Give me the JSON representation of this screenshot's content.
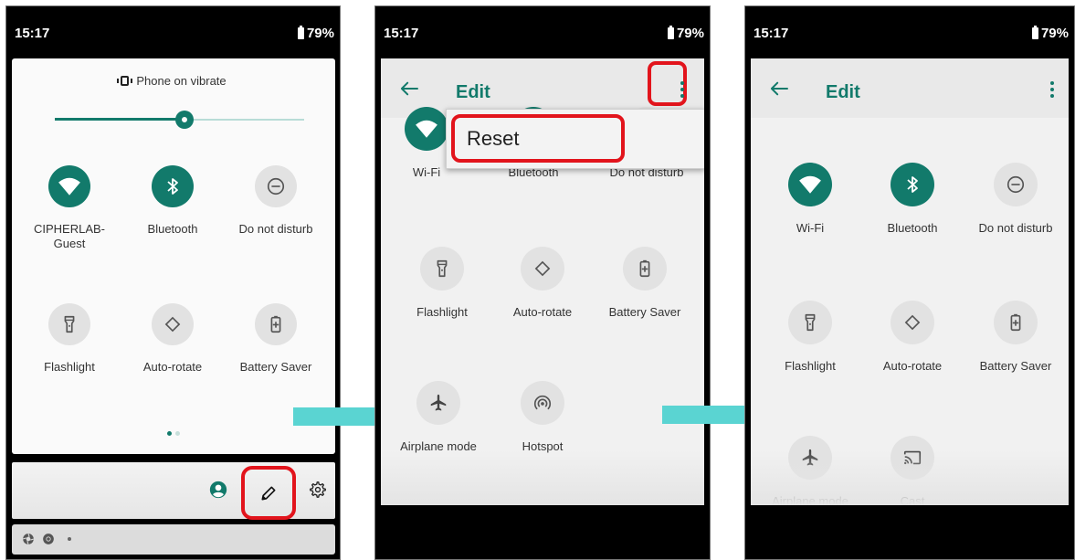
{
  "colors": {
    "accent": "#127a6b",
    "highlight": "#e2141c",
    "arrow": "#5ad4d2"
  },
  "status": {
    "time": "15:17",
    "battery": "79%"
  },
  "panel1": {
    "ringer": "Phone on vibrate",
    "brightness": 0.52,
    "tiles": [
      {
        "label": "CIPHERLAB-\nGuest",
        "icon": "wifi-icon",
        "on": true
      },
      {
        "label": "Bluetooth",
        "icon": "bluetooth-icon",
        "on": true
      },
      {
        "label": "Do not disturb",
        "icon": "do-not-disturb-icon",
        "on": false
      },
      {
        "label": "Flashlight",
        "icon": "flashlight-icon",
        "on": false
      },
      {
        "label": "Auto-rotate",
        "icon": "auto-rotate-icon",
        "on": false
      },
      {
        "label": "Battery Saver",
        "icon": "battery-saver-icon",
        "on": false
      }
    ],
    "page_dots": 2,
    "active_page": 1
  },
  "panel2": {
    "title": "Edit",
    "menu_item": "Reset",
    "tiles": [
      {
        "label": "Wi-Fi"
      },
      {
        "label": "Bluetooth"
      },
      {
        "label": "Do not disturb"
      },
      {
        "label": "Flashlight",
        "icon": "flashlight-icon"
      },
      {
        "label": "Auto-rotate",
        "icon": "auto-rotate-icon"
      },
      {
        "label": "Battery Saver",
        "icon": "battery-saver-icon"
      },
      {
        "label": "Airplane mode",
        "icon": "airplane-icon"
      },
      {
        "label": "Hotspot",
        "icon": "hotspot-icon"
      }
    ]
  },
  "panel3": {
    "title": "Edit",
    "tiles": [
      {
        "label": "Wi-Fi",
        "icon": "wifi-icon",
        "on": true
      },
      {
        "label": "Bluetooth",
        "icon": "bluetooth-icon",
        "on": true
      },
      {
        "label": "Do not disturb",
        "icon": "do-not-disturb-icon",
        "on": false
      },
      {
        "label": "Flashlight",
        "icon": "flashlight-icon",
        "on": false
      },
      {
        "label": "Auto-rotate",
        "icon": "auto-rotate-icon",
        "on": false
      },
      {
        "label": "Battery Saver",
        "icon": "battery-saver-icon",
        "on": false
      },
      {
        "label": "Airplane mode",
        "icon": "airplane-icon",
        "on": false
      },
      {
        "label": "Cast",
        "icon": "cast-icon",
        "on": false
      }
    ]
  }
}
